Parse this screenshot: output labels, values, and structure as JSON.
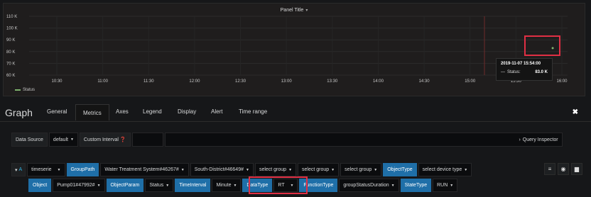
{
  "panel": {
    "title": "Panel Title",
    "tooltip": {
      "time": "2019-11-07 15:54:00",
      "series_label": "Status:",
      "series_value": "83.0 K"
    }
  },
  "chart_data": {
    "type": "line",
    "title": "Panel Title",
    "y_ticks": [
      "110 K",
      "100 K",
      "90 K",
      "80 K",
      "70 K",
      "60 K"
    ],
    "x_ticks": [
      "10:30",
      "11:00",
      "11:30",
      "12:00",
      "12:30",
      "13:00",
      "13:30",
      "14:00",
      "14:30",
      "15:00",
      "15:30",
      "16:00"
    ],
    "ylim": [
      60000,
      110000
    ],
    "series": [
      {
        "name": "Status",
        "color": "#7eb26d",
        "points": [
          {
            "x": "15:54",
            "y": 83000
          }
        ]
      }
    ],
    "legend_position": "bottom-left",
    "grid": true
  },
  "editor": {
    "title": "Graph",
    "tabs": [
      "General",
      "Metrics",
      "Axes",
      "Legend",
      "Display",
      "Alert",
      "Time range"
    ],
    "active_tab": "Metrics"
  },
  "datasource": {
    "label": "Data Source",
    "value": "default",
    "custom_interval_label": "Custom Interval",
    "custom_interval_value": "",
    "query_inspector": "Query Inspector"
  },
  "query": {
    "letter": "A",
    "collapse_glyph": "▾",
    "type": "timeserie",
    "group_path_label": "GroupPath",
    "group1": "Water Treatment System#46267#",
    "group2": "South-District#46649#",
    "group3": "select group",
    "group4": "select group",
    "group5": "select group",
    "object_type_label": "ObjectType",
    "object_type_value": "select device type",
    "object_label": "Object",
    "object_value": "Pump01#47992#",
    "object_param_label": "ObjectParam",
    "object_param_value": "Status",
    "time_interval_label": "TimeInterval",
    "time_interval_value": "Minute",
    "data_type_label": "DataType",
    "data_type_value": "RT",
    "function_type_label": "FunctionType",
    "function_type_value": "groupStatusDuration",
    "state_type_label": "StateType",
    "state_type_value": "RUN"
  }
}
